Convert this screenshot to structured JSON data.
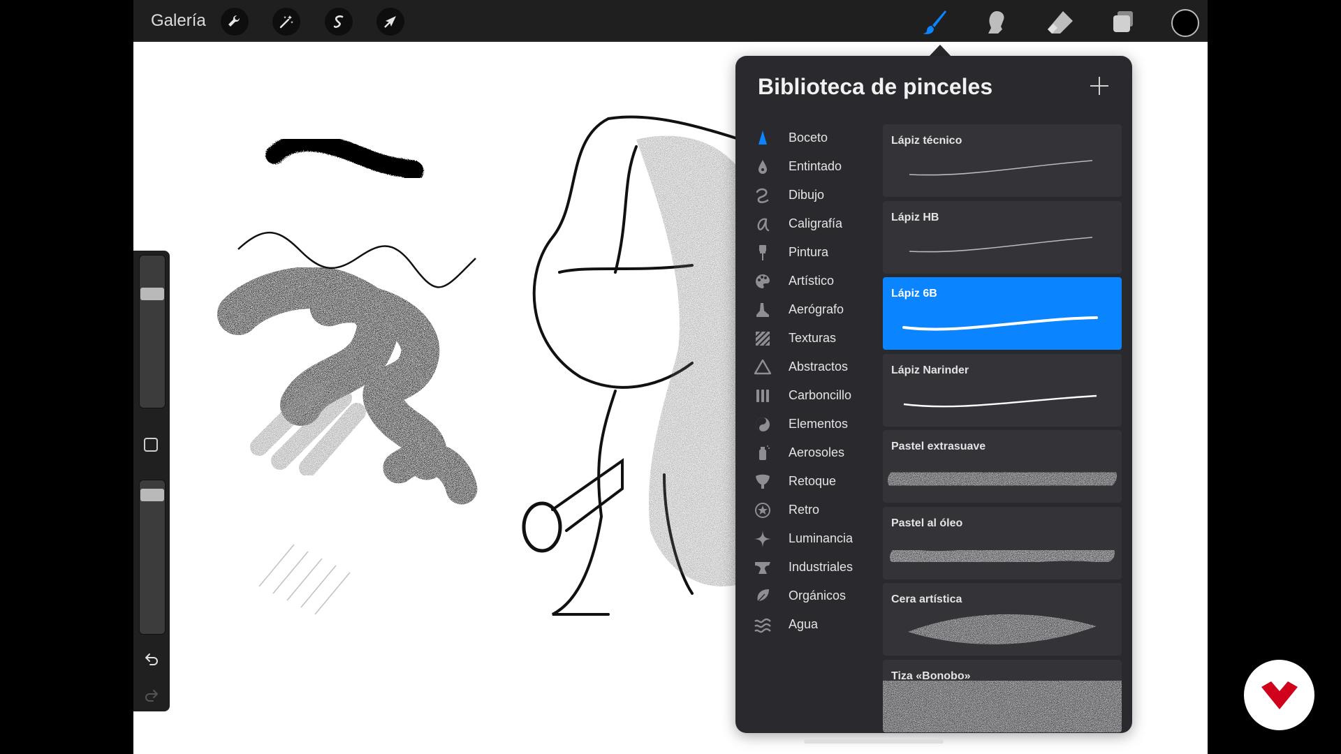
{
  "toolbar": {
    "gallery_label": "Galería",
    "left_tools": [
      "wrench-icon",
      "magic-wand-icon",
      "selection-icon",
      "transform-arrow-icon"
    ],
    "right_tools": [
      "brush-icon",
      "smudge-icon",
      "eraser-icon",
      "layers-icon"
    ],
    "active_tool": "brush-icon",
    "accent_color": "#0a84ff",
    "current_color": "#000000"
  },
  "sidebar": {
    "size_slider_level": 0.77,
    "opacity_slider_level": 0.94,
    "icons": [
      "modify-square-icon",
      "undo-icon",
      "redo-icon"
    ]
  },
  "brush_library": {
    "title": "Biblioteca de pinceles",
    "add_icon": "plus-icon",
    "categories": [
      {
        "label": "Boceto",
        "icon": "pencil-tip-icon",
        "active": true
      },
      {
        "label": "Entintado",
        "icon": "ink-drop-icon"
      },
      {
        "label": "Dibujo",
        "icon": "swirl-icon"
      },
      {
        "label": "Caligrafía",
        "icon": "calligraphy-icon"
      },
      {
        "label": "Pintura",
        "icon": "paintbrush-icon"
      },
      {
        "label": "Artístico",
        "icon": "palette-icon"
      },
      {
        "label": "Aerógrafo",
        "icon": "airbrush-icon"
      },
      {
        "label": "Texturas",
        "icon": "texture-icon"
      },
      {
        "label": "Abstractos",
        "icon": "triangle-icon"
      },
      {
        "label": "Carboncillo",
        "icon": "charcoal-icon"
      },
      {
        "label": "Elementos",
        "icon": "yin-yang-icon"
      },
      {
        "label": "Aerosoles",
        "icon": "spray-can-icon"
      },
      {
        "label": "Retoque",
        "icon": "retouch-icon"
      },
      {
        "label": "Retro",
        "icon": "star-circle-icon"
      },
      {
        "label": "Luminancia",
        "icon": "sparkle-icon"
      },
      {
        "label": "Industriales",
        "icon": "anvil-icon"
      },
      {
        "label": "Orgánicos",
        "icon": "leaf-icon"
      },
      {
        "label": "Agua",
        "icon": "waves-icon"
      }
    ],
    "brushes": [
      {
        "name": "Lápiz técnico",
        "style": "thin"
      },
      {
        "name": "Lápiz HB",
        "style": "thin"
      },
      {
        "name": "Lápiz 6B",
        "style": "bold",
        "selected": true
      },
      {
        "name": "Lápiz Narinder",
        "style": "medium"
      },
      {
        "name": "Pastel extrasuave",
        "style": "soft"
      },
      {
        "name": "Pastel al óleo",
        "style": "textured"
      },
      {
        "name": "Cera artística",
        "style": "wax"
      },
      {
        "name": "Tiza «Bonobo»",
        "style": "chalk"
      }
    ]
  },
  "watermark": {
    "logo": "brand-logo-icon",
    "color": "#d0021b"
  }
}
